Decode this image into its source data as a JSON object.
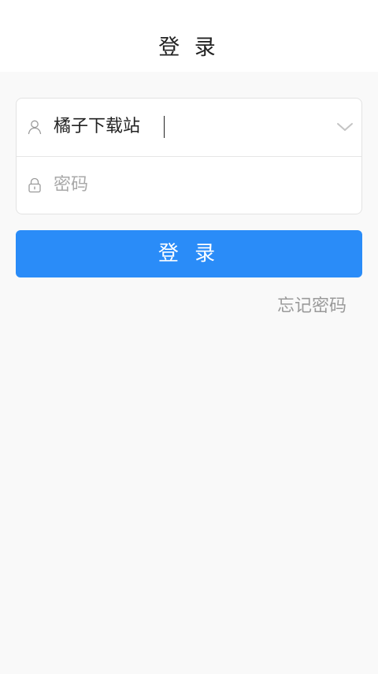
{
  "header": {
    "title": "登 录"
  },
  "form": {
    "username": {
      "value": "橘子下载站",
      "placeholder": "",
      "icon": "user-icon",
      "dropdown_icon": "chevron-down-icon"
    },
    "password": {
      "value": "",
      "placeholder": "密码",
      "icon": "lock-icon"
    }
  },
  "actions": {
    "login_label": "登 录",
    "forgot_label": "忘记密码"
  },
  "colors": {
    "primary": "#2a8cf8",
    "background": "#f9f9f9",
    "text": "#222222",
    "muted": "#9a9a9a"
  }
}
